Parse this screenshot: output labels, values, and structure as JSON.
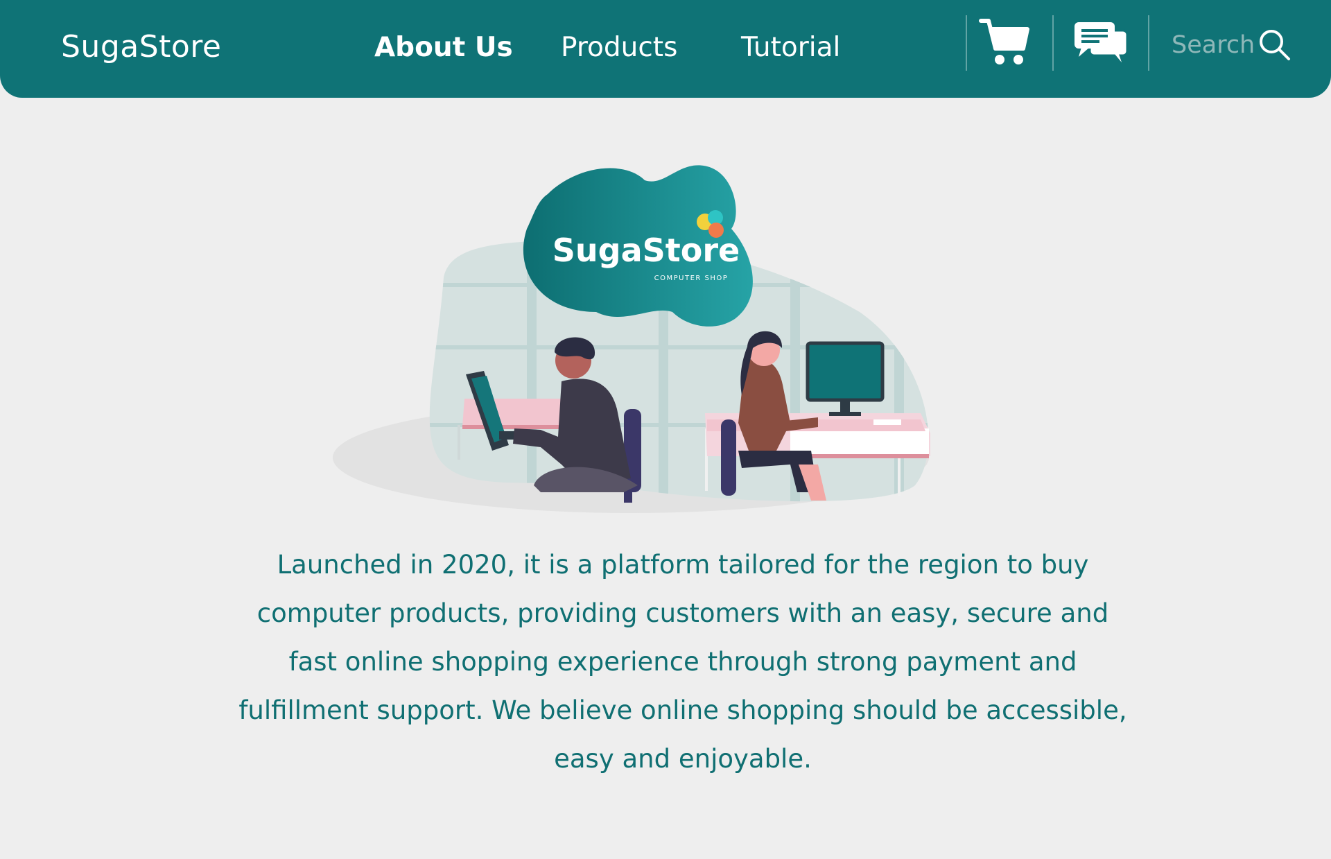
{
  "header": {
    "brand": "SugaStore",
    "nav": [
      {
        "label": "About Us",
        "active": true
      },
      {
        "label": "Products",
        "active": false
      },
      {
        "label": "Tutorial",
        "active": false
      }
    ],
    "search_placeholder": "Search",
    "icons": [
      "cart-icon",
      "chat-icon",
      "search-icon"
    ]
  },
  "hero": {
    "logo_name": "SugaStore",
    "logo_tagline": "COMPUTER SHOP"
  },
  "about": {
    "text": "Launched in 2020, it is a platform tailored for the region to buy computer products, providing customers with an easy, secure and fast online shopping experience through strong payment and fulfillment support. We believe online shopping should be accessible, easy and enjoyable."
  },
  "colors": {
    "primary": "#0f7376",
    "background": "#eeeeee",
    "text": "#0f6f72"
  }
}
